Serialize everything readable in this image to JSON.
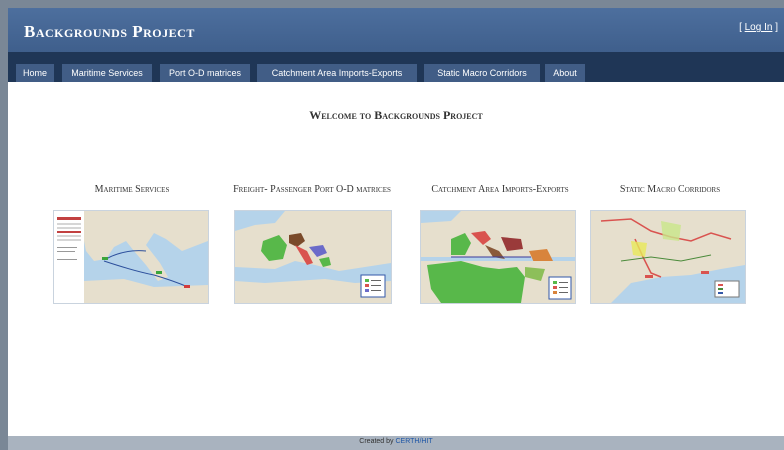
{
  "header": {
    "site_title": "Backgrounds Project",
    "login_open": "[ ",
    "login_label": "Log In",
    "login_close": " ]"
  },
  "nav": {
    "items": [
      {
        "label": "Home"
      },
      {
        "label": "Maritime Services"
      },
      {
        "label": "Port O-D matrices"
      },
      {
        "label": "Catchment Area Imports-Exports"
      },
      {
        "label": "Static Macro Corridors"
      },
      {
        "label": "About"
      }
    ]
  },
  "main": {
    "welcome_title": "Welcome to Backgrounds Project",
    "cards": [
      {
        "title": "Maritime Services",
        "image_icon": "map-thumbnail-icon"
      },
      {
        "title": "Freight- Passenger Port O-D matrices",
        "image_icon": "map-thumbnail-icon"
      },
      {
        "title": "Catchment Area Imports-Exports",
        "image_icon": "map-thumbnail-icon"
      },
      {
        "title": "Static Macro Corridors",
        "image_icon": "map-thumbnail-icon"
      }
    ]
  },
  "footer": {
    "prefix": "Created by ",
    "link_label": "CERTH/HIT"
  },
  "colors": {
    "header_blue": "#4a6b9a",
    "nav_dark": "#1f3656",
    "nav_tab": "#415d86",
    "sea": "#b5d3ea",
    "land": "#e6dfcd",
    "footer_gray": "#a9b3bf",
    "link_blue": "#1e56a6"
  }
}
